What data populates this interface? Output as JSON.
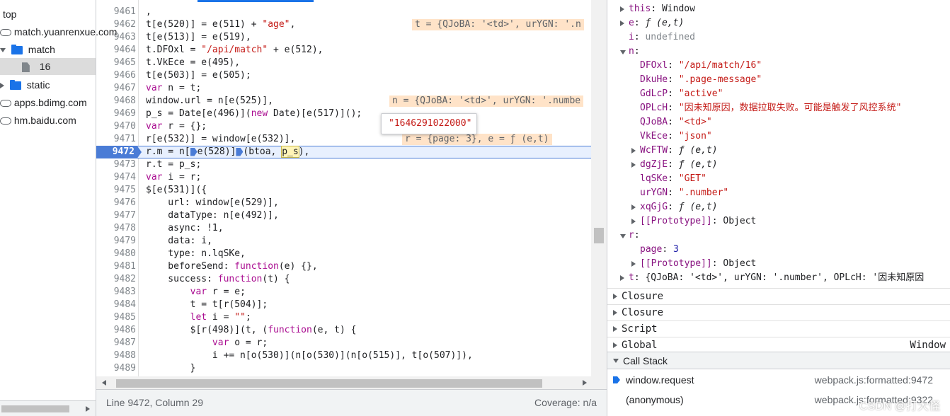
{
  "navigator": {
    "items": [
      {
        "label": "top",
        "kind": "frame"
      },
      {
        "label": "match.yuanrenxue.com",
        "kind": "cloud"
      },
      {
        "label": "match",
        "kind": "folder-open"
      },
      {
        "label": "16",
        "kind": "file"
      },
      {
        "label": "static",
        "kind": "folder-closed"
      },
      {
        "label": "apps.bdimg.com",
        "kind": "cloud"
      },
      {
        "label": "hm.baidu.com",
        "kind": "cloud"
      }
    ]
  },
  "editor": {
    "lines": [
      {
        "n": "9461",
        "code": ","
      },
      {
        "n": "9462",
        "code": "t[e(520)] = e(511) + \"age\","
      },
      {
        "n": "9463",
        "code": "t[e(513)] = e(519),"
      },
      {
        "n": "9464",
        "code": "t.DFOxl = \"/api/match\" + e(512),"
      },
      {
        "n": "9465",
        "code": "t.VkEce = e(495),"
      },
      {
        "n": "9466",
        "code": "t[e(503)] = e(505);"
      },
      {
        "n": "9467",
        "code": "var n = t;"
      },
      {
        "n": "9468",
        "code": "window.url = n[e(525)],"
      },
      {
        "n": "9469",
        "code": "p_s = Date[e(496)](new Date)[e(517)]();"
      },
      {
        "n": "9470",
        "code": "var r = {};"
      },
      {
        "n": "9471",
        "code": "r[e(532)] = window[e(532)],"
      },
      {
        "n": "9472",
        "code": "r.m = n[ e(528)] (btoa, p_s),"
      },
      {
        "n": "9473",
        "code": "r.t = p_s;"
      },
      {
        "n": "9474",
        "code": "var i = r;"
      },
      {
        "n": "9475",
        "code": "$[e(531)]({"
      },
      {
        "n": "9476",
        "code": "    url: window[e(529)],"
      },
      {
        "n": "9477",
        "code": "    dataType: n[e(492)],"
      },
      {
        "n": "9478",
        "code": "    async: !1,"
      },
      {
        "n": "9479",
        "code": "    data: i,"
      },
      {
        "n": "9480",
        "code": "    type: n.lqSKe,"
      },
      {
        "n": "9481",
        "code": "    beforeSend: function(e) {},"
      },
      {
        "n": "9482",
        "code": "    success: function(t) {"
      },
      {
        "n": "9483",
        "code": "        var r = e;"
      },
      {
        "n": "9484",
        "code": "        t = t[r(504)];"
      },
      {
        "n": "9485",
        "code": "        let i = \"\";"
      },
      {
        "n": "9486",
        "code": "        $[r(498)](t, (function(e, t) {"
      },
      {
        "n": "9487",
        "code": "            var o = r;"
      },
      {
        "n": "9488",
        "code": "            i += n[o(530)](n[o(530)](n[o(515)], t[o(507)]),"
      },
      {
        "n": "9489",
        "code": "        }"
      }
    ],
    "current_line": "9472",
    "inline_values": {
      "l9462": "t = {QJoBA: '<td>', urYGN: '.n",
      "l9468": "n = {QJoBA: '<td>', urYGN: '.numbe",
      "l9471": "r = {page: 3}, e = ƒ (e,t)"
    },
    "tooltip": "\"1646291022000\"",
    "status_position": "Line 9472, Column 29",
    "status_coverage": "Coverage: n/a"
  },
  "scope": {
    "rows": [
      {
        "indent": 1,
        "toggle": "right",
        "key": "this",
        "sep": ": ",
        "val": "Window",
        "vtype": "plain"
      },
      {
        "indent": 1,
        "toggle": "right",
        "key": "e",
        "sep": ": ",
        "val": "ƒ (e,t)",
        "vtype": "fn"
      },
      {
        "indent": 1,
        "toggle": "",
        "key": "i",
        "sep": ": ",
        "val": "undefined",
        "vtype": "gray"
      },
      {
        "indent": 1,
        "toggle": "down",
        "key": "n",
        "sep": ":",
        "val": "",
        "vtype": "plain"
      },
      {
        "indent": 2,
        "toggle": "",
        "key": "DFOxl",
        "sep": ": ",
        "val": "\"/api/match/16\"",
        "vtype": "str"
      },
      {
        "indent": 2,
        "toggle": "",
        "key": "DkuHe",
        "sep": ": ",
        "val": "\".page-message\"",
        "vtype": "str"
      },
      {
        "indent": 2,
        "toggle": "",
        "key": "GdLcP",
        "sep": ": ",
        "val": "\"active\"",
        "vtype": "str"
      },
      {
        "indent": 2,
        "toggle": "",
        "key": "OPLcH",
        "sep": ": ",
        "val": "\"因未知原因，数据拉取失败。可能是触发了风控系统\"",
        "vtype": "str"
      },
      {
        "indent": 2,
        "toggle": "",
        "key": "QJoBA",
        "sep": ": ",
        "val": "\"<td>\"",
        "vtype": "str"
      },
      {
        "indent": 2,
        "toggle": "",
        "key": "VkEce",
        "sep": ": ",
        "val": "\"json\"",
        "vtype": "str"
      },
      {
        "indent": 2,
        "toggle": "right",
        "key": "WcFTW",
        "sep": ": ",
        "val": "ƒ (e,t)",
        "vtype": "fn"
      },
      {
        "indent": 2,
        "toggle": "right",
        "key": "dgZjE",
        "sep": ": ",
        "val": "ƒ (e,t)",
        "vtype": "fn"
      },
      {
        "indent": 2,
        "toggle": "",
        "key": "lqSKe",
        "sep": ": ",
        "val": "\"GET\"",
        "vtype": "str"
      },
      {
        "indent": 2,
        "toggle": "",
        "key": "urYGN",
        "sep": ": ",
        "val": "\".number\"",
        "vtype": "str"
      },
      {
        "indent": 2,
        "toggle": "right",
        "key": "xqGjG",
        "sep": ": ",
        "val": "ƒ (e,t)",
        "vtype": "fn"
      },
      {
        "indent": 2,
        "toggle": "right",
        "key": "[[Prototype]]",
        "sep": ": ",
        "val": "Object",
        "vtype": "plain"
      },
      {
        "indent": 1,
        "toggle": "down",
        "key": "r",
        "sep": ":",
        "val": "",
        "vtype": "plain"
      },
      {
        "indent": 2,
        "toggle": "",
        "key": "page",
        "sep": ": ",
        "val": "3",
        "vtype": "num"
      },
      {
        "indent": 2,
        "toggle": "right",
        "key": "[[Prototype]]",
        "sep": ": ",
        "val": "Object",
        "vtype": "plain"
      },
      {
        "indent": 1,
        "toggle": "right",
        "key": "t",
        "sep": ": ",
        "val": "{QJoBA: '<td>', urYGN: '.number', OPLcH: '因未知原因",
        "vtype": "plain"
      }
    ],
    "sections": [
      {
        "label": "Closure",
        "right": ""
      },
      {
        "label": "Closure",
        "right": ""
      },
      {
        "label": "Script",
        "right": ""
      },
      {
        "label": "Global",
        "right": "Window"
      }
    ]
  },
  "call_stack": {
    "title": "Call Stack",
    "frames": [
      {
        "name": "window.request",
        "location": "webpack.js:formatted:9472",
        "active": true
      },
      {
        "name": "(anonymous)",
        "location": "webpack.js:formatted:9322",
        "active": false
      }
    ]
  },
  "watermark": "CSDN @打大怪",
  "colors": {
    "accent": "#1a73e8",
    "breakpoint": "#4a7cd6",
    "string": "#c41a16",
    "keyword": "#aa0d91",
    "inline_value_bg": "#ffe3c8"
  }
}
